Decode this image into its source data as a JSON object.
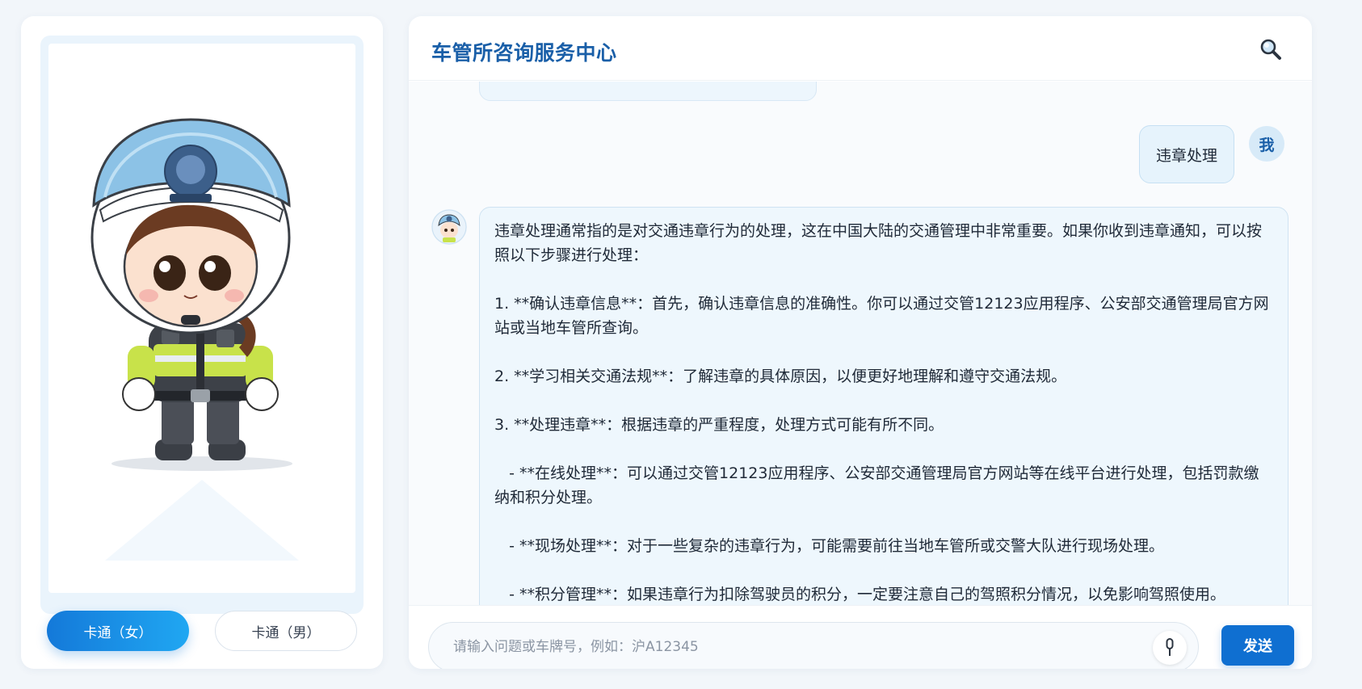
{
  "avatar_panel": {
    "character_image": "cartoon-traffic-police-officer-female",
    "buttons": [
      {
        "label": "卡通（女）",
        "active": true
      },
      {
        "label": "卡通（男）",
        "active": false
      }
    ]
  },
  "chat": {
    "title": "车管所咨询服务中心",
    "search_icon": "magnifier-icon",
    "messages": [
      {
        "role": "user",
        "avatar_label": "我",
        "text": "违章处理"
      },
      {
        "role": "assistant",
        "avatar": "cartoon-officer-avatar",
        "paragraphs": [
          "违章处理通常指的是对交通违章行为的处理，这在中国大陆的交通管理中非常重要。如果你收到违章通知，可以按照以下步骤进行处理：",
          "1. **确认违章信息**：首先，确认违章信息的准确性。你可以通过交管12123应用程序、公安部交通管理局官方网站或当地车管所查询。",
          "2. **学习相关交通法规**：了解违章的具体原因，以便更好地理解和遵守交通法规。",
          "3. **处理违章**：根据违章的严重程度，处理方式可能有所不同。",
          "   - **在线处理**：可以通过交管12123应用程序、公安部交通管理局官方网站等在线平台进行处理，包括罚款缴纳和积分处理。",
          "   - **现场处理**：对于一些复杂的违章行为，可能需要前往当地车管所或交警大队进行现场处理。",
          "   - **积分管理**：如果违章行为扣除驾驶员的积分，一定要注意自己的驾照积分情况，以免影响驾照使用。"
        ]
      }
    ],
    "input": {
      "placeholder": "请输入问题或车牌号，例如：沪A12345",
      "value": "",
      "mic_icon": "microphone-icon"
    },
    "send_label": "发送"
  },
  "colors": {
    "accent": "#1a5fa8",
    "primary_button": "#0f6fd1",
    "bubble_bg": "#eef7fd",
    "page_bg": "#f2f6fa"
  }
}
